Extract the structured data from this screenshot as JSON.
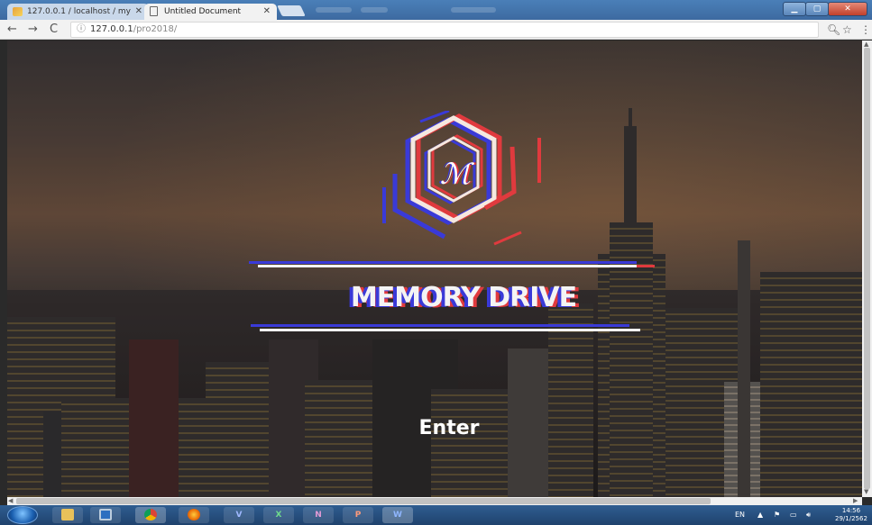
{
  "browser": {
    "tabs": [
      {
        "title": "127.0.0.1 / localhost / my",
        "active": false
      },
      {
        "title": "Untitled Document",
        "active": true
      }
    ],
    "url_host": "127.0.0.1",
    "url_path": "/pro2018/"
  },
  "page": {
    "logo_text": "ℳ",
    "title": "MEMORY DRIVE",
    "enter_label": "Enter",
    "colors": {
      "accent_blue": "#3a3ad8",
      "accent_red": "#e03a3e",
      "text": "#ffffff"
    }
  },
  "taskbar": {
    "apps": [
      {
        "name": "explorer",
        "label": ""
      },
      {
        "name": "media",
        "label": ""
      },
      {
        "name": "chrome",
        "label": ""
      },
      {
        "name": "firefox",
        "label": ""
      },
      {
        "name": "visio",
        "label": "V"
      },
      {
        "name": "excel",
        "label": "X"
      },
      {
        "name": "onenote",
        "label": "N"
      },
      {
        "name": "powerpoint",
        "label": "P"
      },
      {
        "name": "word",
        "label": "W"
      }
    ],
    "language": "EN",
    "time": "14:56",
    "date": "29/1/2562"
  }
}
